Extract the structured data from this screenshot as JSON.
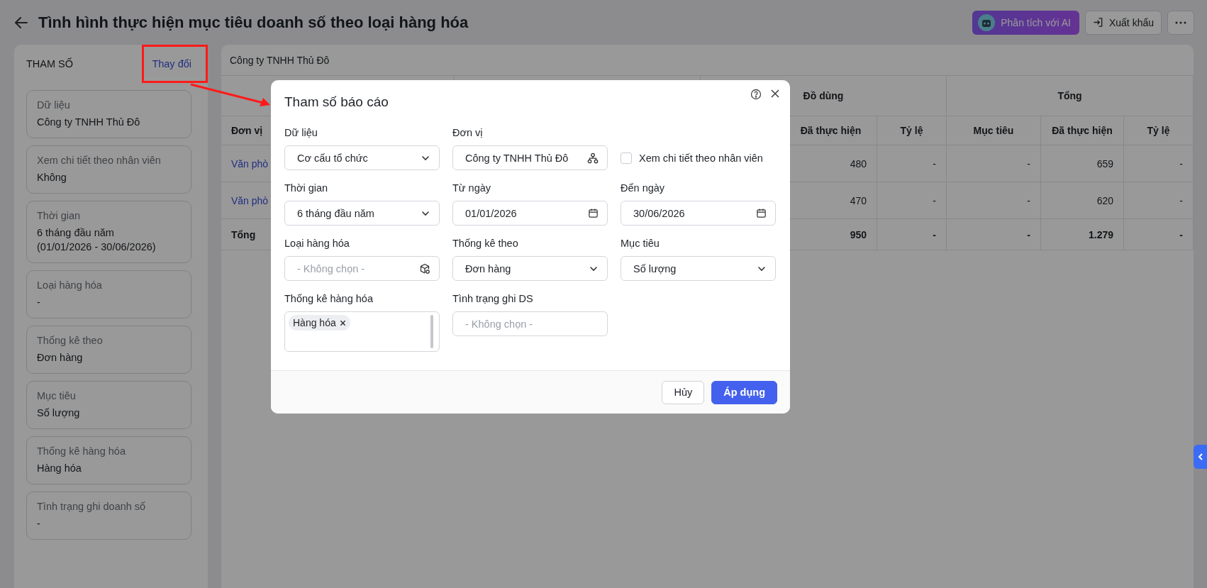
{
  "header": {
    "title": "Tình hình thực hiện mục tiêu doanh số theo loại hàng hóa",
    "buttons": [
      {
        "kind": "ai",
        "label": "Phân tích với AI"
      },
      {
        "kind": "export",
        "label": "Xuất khẩu"
      },
      {
        "kind": "more"
      }
    ]
  },
  "sidebar": {
    "title": "THAM SỐ",
    "action": "Thay đổi",
    "items": [
      {
        "label": "Dữ liệu",
        "lines": [
          "Công ty TNHH Thủ Đô"
        ]
      },
      {
        "label": "Xem chi tiết theo nhân viên",
        "lines": [
          "Không"
        ]
      },
      {
        "label": "Thời gian",
        "lines": [
          "6 tháng đầu năm",
          "(01/01/2026 - 30/06/2026)"
        ]
      },
      {
        "label": "Loại hàng hóa",
        "lines": [
          "-"
        ]
      },
      {
        "label": "Thống kê theo",
        "lines": [
          "Đơn hàng"
        ]
      },
      {
        "label": "Mục tiêu",
        "lines": [
          "Số lượng"
        ]
      },
      {
        "label": "Thống kê hàng hóa",
        "lines": [
          "Hàng hóa"
        ]
      },
      {
        "label": "Tình trạng ghi doanh số",
        "lines": [
          "-"
        ]
      }
    ]
  },
  "report": {
    "unit": "Công ty TNHH Thủ Đô",
    "table": {
      "unit_column": "Đơn vị",
      "groups": [
        {
          "label": "Đồ dùng",
          "columns": [
            "Đã thực hiện",
            "Tỷ lệ"
          ]
        },
        {
          "label": "Tổng",
          "columns": [
            "Mục tiêu",
            "Đã thực hiện",
            "Tỷ lệ"
          ]
        }
      ],
      "rows": [
        {
          "kind": "link",
          "unit": "Văn phò",
          "cells": [
            "480",
            "-",
            "-",
            "659",
            "-"
          ]
        },
        {
          "kind": "link",
          "unit": "Văn phò",
          "cells": [
            "470",
            "-",
            "-",
            "620",
            "-"
          ]
        },
        {
          "kind": "total",
          "unit": "Tổng",
          "cells": [
            "950",
            "-",
            "-",
            "1.279",
            "-"
          ]
        }
      ]
    }
  },
  "dialog": {
    "title": "Tham số báo cáo",
    "fields": [
      {
        "kind": "select",
        "label": "Dữ liệu",
        "value": "Cơ cấu tổ chức"
      },
      {
        "kind": "org-picker",
        "label": "Đơn vị",
        "value": "Công ty TNHH Thủ Đô"
      },
      {
        "kind": "checkbox",
        "label": "Xem chi tiết theo nhân viên",
        "checked": false
      },
      {
        "kind": "select",
        "label": "Thời gian",
        "value": "6 tháng đầu năm"
      },
      {
        "kind": "date",
        "label": "Từ ngày",
        "value": "01/01/2026"
      },
      {
        "kind": "date",
        "label": "Đến ngày",
        "value": "30/06/2026"
      },
      {
        "kind": "goods-picker",
        "label": "Loại hàng hóa",
        "placeholder": "- Không chọn -"
      },
      {
        "kind": "select",
        "label": "Thống kê theo",
        "value": "Đơn hàng"
      },
      {
        "kind": "select",
        "label": "Mục tiêu",
        "value": "Số lượng"
      },
      {
        "kind": "tags",
        "label": "Thống kê hàng hóa",
        "tags": [
          "Hàng hóa"
        ]
      },
      {
        "kind": "input",
        "label": "Tình trạng ghi DS",
        "placeholder": "- Không chọn -"
      }
    ],
    "buttons": [
      {
        "kind": "secondary",
        "label": "Hủy"
      },
      {
        "kind": "primary",
        "label": "Áp dụng"
      }
    ]
  }
}
